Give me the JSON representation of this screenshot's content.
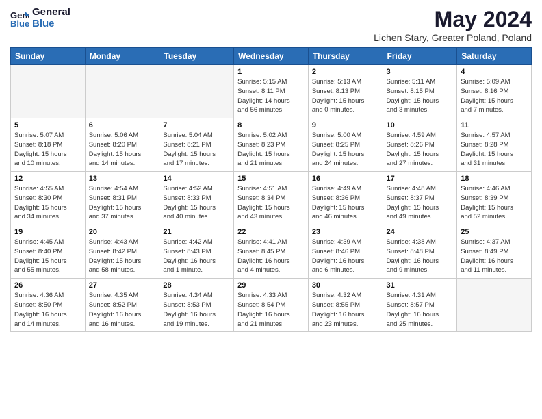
{
  "logo": {
    "line1": "General",
    "line2": "Blue"
  },
  "title": "May 2024",
  "subtitle": "Lichen Stary, Greater Poland, Poland",
  "days_of_week": [
    "Sunday",
    "Monday",
    "Tuesday",
    "Wednesday",
    "Thursday",
    "Friday",
    "Saturday"
  ],
  "weeks": [
    [
      {
        "num": "",
        "info": ""
      },
      {
        "num": "",
        "info": ""
      },
      {
        "num": "",
        "info": ""
      },
      {
        "num": "1",
        "info": "Sunrise: 5:15 AM\nSunset: 8:11 PM\nDaylight: 14 hours\nand 56 minutes."
      },
      {
        "num": "2",
        "info": "Sunrise: 5:13 AM\nSunset: 8:13 PM\nDaylight: 15 hours\nand 0 minutes."
      },
      {
        "num": "3",
        "info": "Sunrise: 5:11 AM\nSunset: 8:15 PM\nDaylight: 15 hours\nand 3 minutes."
      },
      {
        "num": "4",
        "info": "Sunrise: 5:09 AM\nSunset: 8:16 PM\nDaylight: 15 hours\nand 7 minutes."
      }
    ],
    [
      {
        "num": "5",
        "info": "Sunrise: 5:07 AM\nSunset: 8:18 PM\nDaylight: 15 hours\nand 10 minutes."
      },
      {
        "num": "6",
        "info": "Sunrise: 5:06 AM\nSunset: 8:20 PM\nDaylight: 15 hours\nand 14 minutes."
      },
      {
        "num": "7",
        "info": "Sunrise: 5:04 AM\nSunset: 8:21 PM\nDaylight: 15 hours\nand 17 minutes."
      },
      {
        "num": "8",
        "info": "Sunrise: 5:02 AM\nSunset: 8:23 PM\nDaylight: 15 hours\nand 21 minutes."
      },
      {
        "num": "9",
        "info": "Sunrise: 5:00 AM\nSunset: 8:25 PM\nDaylight: 15 hours\nand 24 minutes."
      },
      {
        "num": "10",
        "info": "Sunrise: 4:59 AM\nSunset: 8:26 PM\nDaylight: 15 hours\nand 27 minutes."
      },
      {
        "num": "11",
        "info": "Sunrise: 4:57 AM\nSunset: 8:28 PM\nDaylight: 15 hours\nand 31 minutes."
      }
    ],
    [
      {
        "num": "12",
        "info": "Sunrise: 4:55 AM\nSunset: 8:30 PM\nDaylight: 15 hours\nand 34 minutes."
      },
      {
        "num": "13",
        "info": "Sunrise: 4:54 AM\nSunset: 8:31 PM\nDaylight: 15 hours\nand 37 minutes."
      },
      {
        "num": "14",
        "info": "Sunrise: 4:52 AM\nSunset: 8:33 PM\nDaylight: 15 hours\nand 40 minutes."
      },
      {
        "num": "15",
        "info": "Sunrise: 4:51 AM\nSunset: 8:34 PM\nDaylight: 15 hours\nand 43 minutes."
      },
      {
        "num": "16",
        "info": "Sunrise: 4:49 AM\nSunset: 8:36 PM\nDaylight: 15 hours\nand 46 minutes."
      },
      {
        "num": "17",
        "info": "Sunrise: 4:48 AM\nSunset: 8:37 PM\nDaylight: 15 hours\nand 49 minutes."
      },
      {
        "num": "18",
        "info": "Sunrise: 4:46 AM\nSunset: 8:39 PM\nDaylight: 15 hours\nand 52 minutes."
      }
    ],
    [
      {
        "num": "19",
        "info": "Sunrise: 4:45 AM\nSunset: 8:40 PM\nDaylight: 15 hours\nand 55 minutes."
      },
      {
        "num": "20",
        "info": "Sunrise: 4:43 AM\nSunset: 8:42 PM\nDaylight: 15 hours\nand 58 minutes."
      },
      {
        "num": "21",
        "info": "Sunrise: 4:42 AM\nSunset: 8:43 PM\nDaylight: 16 hours\nand 1 minute."
      },
      {
        "num": "22",
        "info": "Sunrise: 4:41 AM\nSunset: 8:45 PM\nDaylight: 16 hours\nand 4 minutes."
      },
      {
        "num": "23",
        "info": "Sunrise: 4:39 AM\nSunset: 8:46 PM\nDaylight: 16 hours\nand 6 minutes."
      },
      {
        "num": "24",
        "info": "Sunrise: 4:38 AM\nSunset: 8:48 PM\nDaylight: 16 hours\nand 9 minutes."
      },
      {
        "num": "25",
        "info": "Sunrise: 4:37 AM\nSunset: 8:49 PM\nDaylight: 16 hours\nand 11 minutes."
      }
    ],
    [
      {
        "num": "26",
        "info": "Sunrise: 4:36 AM\nSunset: 8:50 PM\nDaylight: 16 hours\nand 14 minutes."
      },
      {
        "num": "27",
        "info": "Sunrise: 4:35 AM\nSunset: 8:52 PM\nDaylight: 16 hours\nand 16 minutes."
      },
      {
        "num": "28",
        "info": "Sunrise: 4:34 AM\nSunset: 8:53 PM\nDaylight: 16 hours\nand 19 minutes."
      },
      {
        "num": "29",
        "info": "Sunrise: 4:33 AM\nSunset: 8:54 PM\nDaylight: 16 hours\nand 21 minutes."
      },
      {
        "num": "30",
        "info": "Sunrise: 4:32 AM\nSunset: 8:55 PM\nDaylight: 16 hours\nand 23 minutes."
      },
      {
        "num": "31",
        "info": "Sunrise: 4:31 AM\nSunset: 8:57 PM\nDaylight: 16 hours\nand 25 minutes."
      },
      {
        "num": "",
        "info": ""
      }
    ]
  ]
}
